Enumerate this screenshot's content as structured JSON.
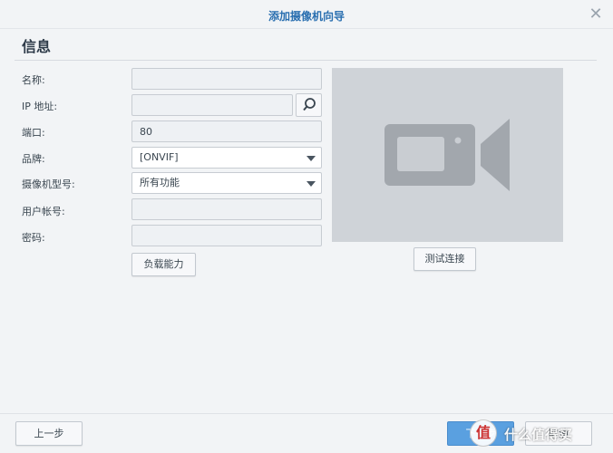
{
  "dialog": {
    "title": "添加摄像机向导",
    "section_title": "信息"
  },
  "form": {
    "name_label": "名称:",
    "name_value": "",
    "ip_label": "IP 地址:",
    "ip_value": "",
    "port_label": "端口:",
    "port_value": "80",
    "brand_label": "品牌:",
    "brand_value": "[ONVIF]",
    "model_label": "摄像机型号:",
    "model_value": "所有功能",
    "user_label": "用户帐号:",
    "user_value": "",
    "password_label": "密码:",
    "password_value": "",
    "capability_button": "负载能力"
  },
  "preview": {
    "test_button": "测试连接",
    "icon": "video-camera-icon"
  },
  "footer": {
    "back_button": "上一步",
    "next_button": "下一步",
    "cancel_button": "取消"
  },
  "watermark": {
    "logo": "值",
    "text": "什么值得买"
  },
  "colors": {
    "accent": "#2a6fb0",
    "primary_button": "#5aa0e0",
    "preview_bg": "#cfd3d8",
    "camera_icon": "#a2a7ad"
  }
}
